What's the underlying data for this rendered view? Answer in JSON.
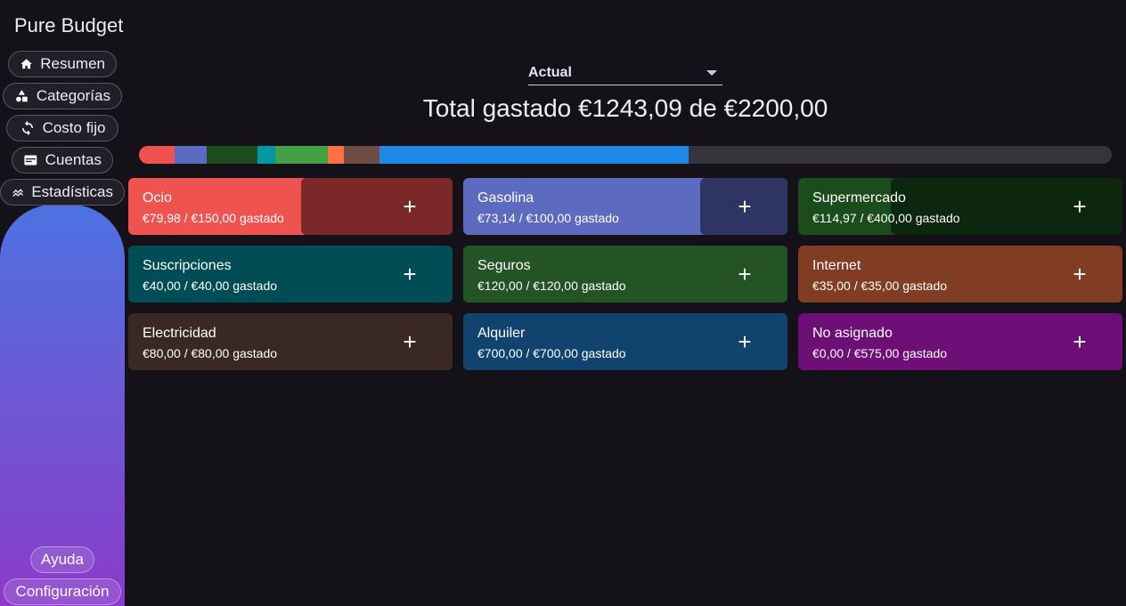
{
  "app": {
    "title": "Pure Budget"
  },
  "nav": {
    "items": [
      {
        "label": "Resumen",
        "icon": "home-icon"
      },
      {
        "label": "Categorías",
        "icon": "shapes-icon"
      },
      {
        "label": "Costo fijo",
        "icon": "refresh-icon"
      },
      {
        "label": "Cuentas",
        "icon": "wallet-icon"
      },
      {
        "label": "Estadísticas",
        "icon": "stats-icon"
      }
    ],
    "bottom": [
      {
        "label": "Ayuda"
      },
      {
        "label": "Configuración"
      }
    ]
  },
  "header": {
    "period": "Actual",
    "total": "Total gastado €1243,09 de €2200,00"
  },
  "budget_bar": {
    "total_budget": 2200.0,
    "segments": [
      {
        "name": "Ocio",
        "amount": 79.98,
        "color": "#ef5350"
      },
      {
        "name": "Gasolina",
        "amount": 73.14,
        "color": "#5c6bc0"
      },
      {
        "name": "Supermercado",
        "amount": 114.97,
        "color": "#1b4d1c"
      },
      {
        "name": "Suscripciones",
        "amount": 40.0,
        "color": "#0097a7"
      },
      {
        "name": "Seguros",
        "amount": 120.0,
        "color": "#43a047"
      },
      {
        "name": "Internet",
        "amount": 35.0,
        "color": "#ff7043"
      },
      {
        "name": "Electricidad",
        "amount": 80.0,
        "color": "#6d4c41"
      },
      {
        "name": "Alquiler",
        "amount": 700.0,
        "color": "#1e88e5"
      }
    ]
  },
  "categories": [
    {
      "name": "Ocio",
      "amount": "€79,98 / €150,00 gastado",
      "spent_fraction": 0.533,
      "color": "#ef5350",
      "remaining_color": "#7b2828"
    },
    {
      "name": "Gasolina",
      "amount": "€73,14 / €100,00 gastado",
      "spent_fraction": 0.731,
      "color": "#5c6bc0",
      "remaining_color": "#2f3563"
    },
    {
      "name": "Supermercado",
      "amount": "€114,97 / €400,00 gastado",
      "spent_fraction": 0.287,
      "color": "#1b4d1c",
      "remaining_color": "#0d260e"
    },
    {
      "name": "Suscripciones",
      "amount": "€40,00 / €40,00 gastado",
      "spent_fraction": 1.0,
      "color": "#004d55",
      "remaining_color": "#004d55"
    },
    {
      "name": "Seguros",
      "amount": "€120,00 / €120,00 gastado",
      "spent_fraction": 1.0,
      "color": "#245325",
      "remaining_color": "#245325"
    },
    {
      "name": "Internet",
      "amount": "€35,00 / €35,00 gastado",
      "spent_fraction": 1.0,
      "color": "#813c24",
      "remaining_color": "#813c24"
    },
    {
      "name": "Electricidad",
      "amount": "€80,00 / €80,00 gastado",
      "spent_fraction": 1.0,
      "color": "#3a2922",
      "remaining_color": "#3a2922"
    },
    {
      "name": "Alquiler",
      "amount": "€700,00 / €700,00 gastado",
      "spent_fraction": 1.0,
      "color": "#10446f",
      "remaining_color": "#10446f"
    },
    {
      "name": "No asignado",
      "amount": "€0,00 / €575,00 gastado",
      "spent_fraction": 1.0,
      "color": "#6e0f77",
      "remaining_color": "#6e0f77"
    }
  ],
  "card_action": {
    "add_glyph": "+"
  }
}
